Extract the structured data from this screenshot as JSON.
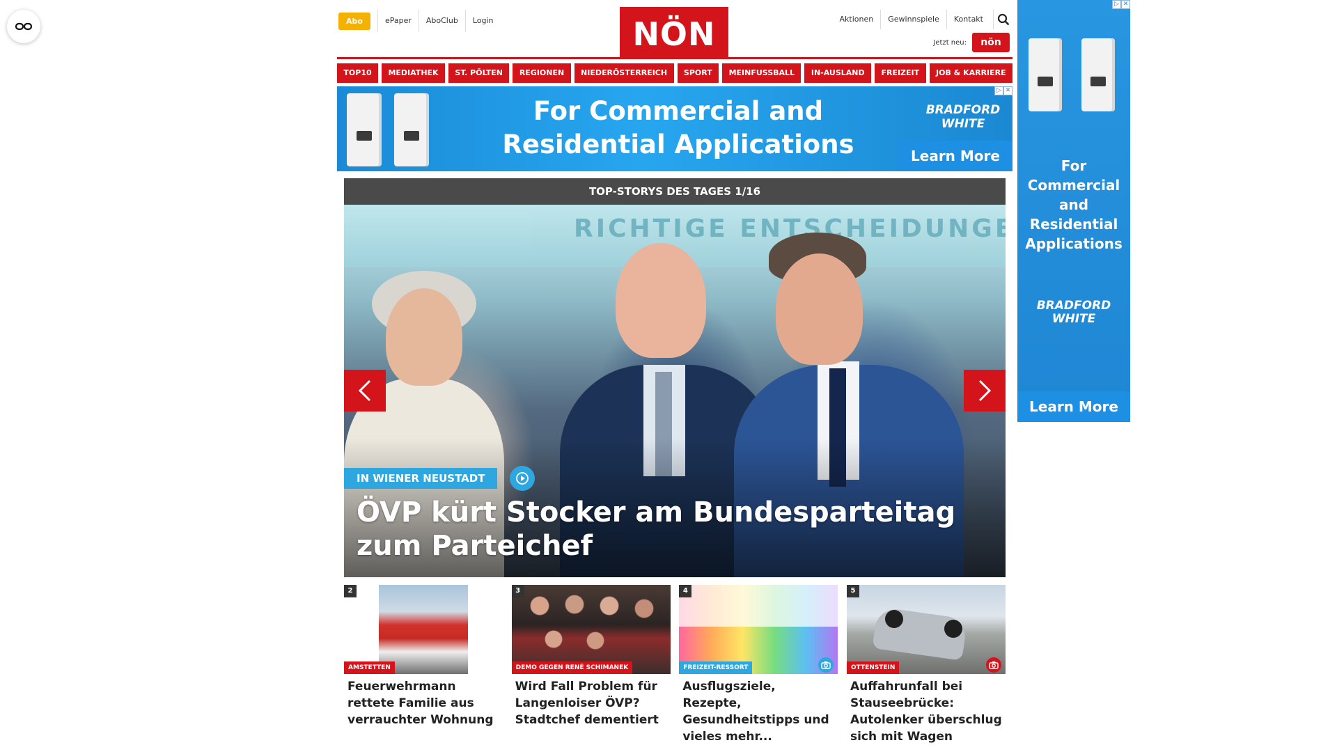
{
  "header": {
    "abo_label": "Abo",
    "left_links": [
      "ePaper",
      "AboClub",
      "Login"
    ],
    "logo_text": "NÖN",
    "right_links": [
      "Aktionen",
      "Gewinnspiele",
      "Kontakt"
    ],
    "jetzt_label": "Jetzt neu:",
    "jetzt_badge": "nön"
  },
  "nav": {
    "items": [
      "TOP10",
      "MEDIATHEK",
      "ST. PÖLTEN",
      "REGIONEN",
      "NIEDERÖSTERREICH",
      "SPORT",
      "MEINFUSSBALL",
      "IN-AUSLAND",
      "FREIZEIT",
      "JOB & KARRIERE"
    ]
  },
  "ad_top": {
    "headline_line1": "For Commercial and",
    "headline_line2": "Residential Applications",
    "brand": "BRADFORD WHITE",
    "cta": "Learn More",
    "info_glyph": "▷",
    "close_glyph": "✕"
  },
  "top_story": {
    "bar_label": "TOP-STORYS DES TAGES 1/16",
    "banner_text": "RICHTIGE ENTSCHEIDUNGEN.",
    "tag": "IN WIENER NEUSTADT",
    "headline": "ÖVP kürt Stocker am Bundesparteitag zum Parteichef"
  },
  "teasers": [
    {
      "num": "2",
      "tag": "AMSTETTEN",
      "title": "Feuerwehrmann rettete Familie aus verrauchter Wohnung"
    },
    {
      "num": "3",
      "tag": "DEMO GEGEN RENÉ SCHIMANEK",
      "title": "Wird Fall Problem für Langenloiser ÖVP? Stadtchef dementiert"
    },
    {
      "num": "4",
      "tag": "FREIZEIT-RESSORT",
      "title": "Ausflugsziele, Rezepte, Gesundheitstipps und vieles mehr..."
    },
    {
      "num": "5",
      "tag": "OTTENSTEIN",
      "title": "Auffahrunfall bei Stauseebrücke: Autolenker überschlug sich mit Wagen"
    }
  ],
  "ad_side": {
    "headline": "For Commercial and Residential Applications",
    "brand": "BRADFORD WHITE",
    "cta": "Learn More"
  },
  "colors": {
    "brand_red": "#d4141b",
    "abo_yellow": "#f5b100",
    "accent_blue": "#2ea7e0",
    "top_bar": "#4a4a4a"
  }
}
